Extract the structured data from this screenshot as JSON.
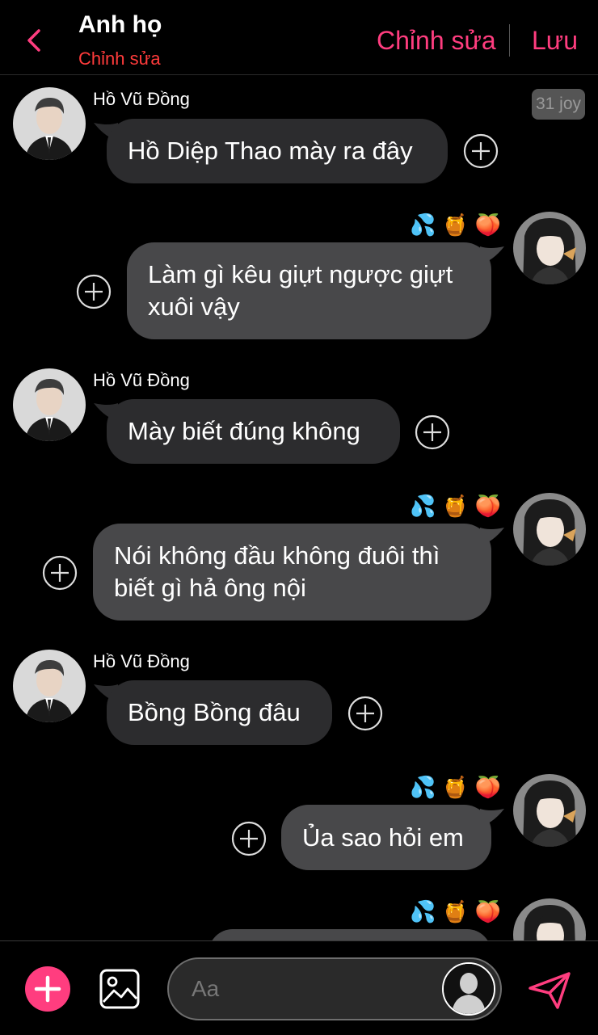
{
  "header": {
    "title": "Anh họ",
    "subtitle": "Chỉnh sửa",
    "edit_label": "Chỉnh sửa",
    "save_label": "Lưu"
  },
  "time_badge": "31 joy",
  "messages": [
    {
      "direction": "incoming",
      "sender": "Hồ Vũ Đồng",
      "text": "Hồ Diệp Thao mày ra đây"
    },
    {
      "direction": "outgoing",
      "reactions": [
        "💦",
        "🍯",
        "🍑"
      ],
      "text_lines": [
        "Làm gì kêu giựt ngược giựt",
        "xuôi vậy"
      ]
    },
    {
      "direction": "incoming",
      "sender": "Hồ Vũ Đồng",
      "text": "Mày biết đúng không"
    },
    {
      "direction": "outgoing",
      "reactions": [
        "💦",
        "🍯",
        "🍑"
      ],
      "text_lines": [
        "Nói không đầu không đuôi thì",
        "biết gì hả ông nội"
      ]
    },
    {
      "direction": "incoming",
      "sender": "Hồ Vũ Đồng",
      "text": "Bồng Bồng đâu"
    },
    {
      "direction": "outgoing",
      "reactions": [
        "💦",
        "🍯",
        "🍑"
      ],
      "text": "Ủa sao hỏi em"
    },
    {
      "direction": "outgoing",
      "reactions": [
        "💦",
        "🍯",
        "🍑"
      ],
      "text": ""
    }
  ],
  "composer": {
    "placeholder": "Aa"
  },
  "colors": {
    "accent": "#ff3d7f",
    "subtitle_red": "#ff3b3b",
    "incoming_bubble": "#2c2c2e",
    "outgoing_bubble": "#48484a",
    "background": "#000000"
  },
  "icons": {
    "back": "chevron-left-icon",
    "add": "plus-icon",
    "image": "image-icon",
    "profile": "person-silhouette-icon",
    "send": "paper-plane-icon",
    "bubble_action": "circle-plus-icon"
  }
}
